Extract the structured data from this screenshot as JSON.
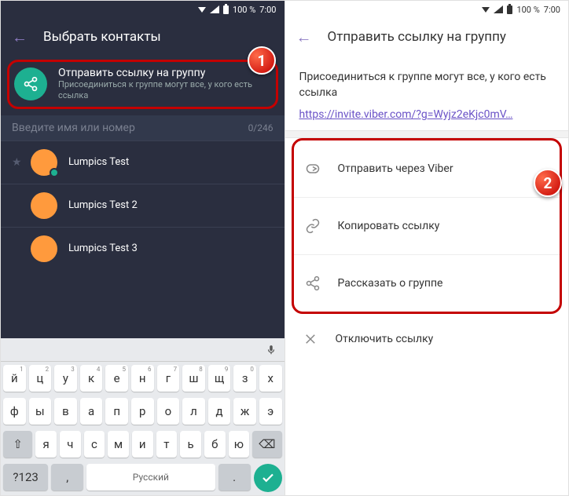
{
  "status": {
    "battery": "100 %",
    "time": "7:00"
  },
  "left": {
    "header_title": "Выбрать контакты",
    "share": {
      "title": "Отправить ссылку на группу",
      "subtitle": "Присоединиться к группе могут все, у кого есть ссылка"
    },
    "search_placeholder": "Введите имя или номер",
    "counter": "0/246",
    "contacts": [
      {
        "name": "Lumpics Test",
        "starred": true,
        "checked": true
      },
      {
        "name": "Lumpics Test 2",
        "starred": false,
        "checked": false
      },
      {
        "name": "Lumpics Test 3",
        "starred": false,
        "checked": false
      }
    ],
    "keyboard": {
      "row1": [
        {
          "k": "й",
          "h": "1"
        },
        {
          "k": "ц",
          "h": "2"
        },
        {
          "k": "у",
          "h": "3"
        },
        {
          "k": "к",
          "h": "4"
        },
        {
          "k": "е",
          "h": "5"
        },
        {
          "k": "н",
          "h": "6"
        },
        {
          "k": "г",
          "h": "7"
        },
        {
          "k": "ш",
          "h": "8"
        },
        {
          "k": "щ",
          "h": "9"
        },
        {
          "k": "з",
          "h": "0"
        },
        {
          "k": "х",
          "h": ""
        }
      ],
      "row2": [
        "ф",
        "ы",
        "в",
        "а",
        "п",
        "р",
        "о",
        "л",
        "д",
        "ж",
        "э"
      ],
      "row3": [
        "я",
        "ч",
        "с",
        "м",
        "и",
        "т",
        "ь",
        "б",
        "ю"
      ],
      "shift": "⇧",
      "bksp": "⌫",
      "numkey": "?123",
      "comma": ",",
      "space_label": "Русский",
      "period": "."
    }
  },
  "right": {
    "header_title": "Отправить ссылку на группу",
    "info": "Присоединиться к группе могут все, у кого есть ссылка",
    "link": "https://invite.viber.com/?g=Wyjz2eKjc0mV…",
    "options": [
      {
        "label": "Отправить через Viber",
        "icon": "send"
      },
      {
        "label": "Копировать ссылку",
        "icon": "link"
      },
      {
        "label": "Рассказать о группе",
        "icon": "share"
      }
    ],
    "disable": "Отключить ссылку"
  },
  "markers": {
    "one": "1",
    "two": "2"
  }
}
